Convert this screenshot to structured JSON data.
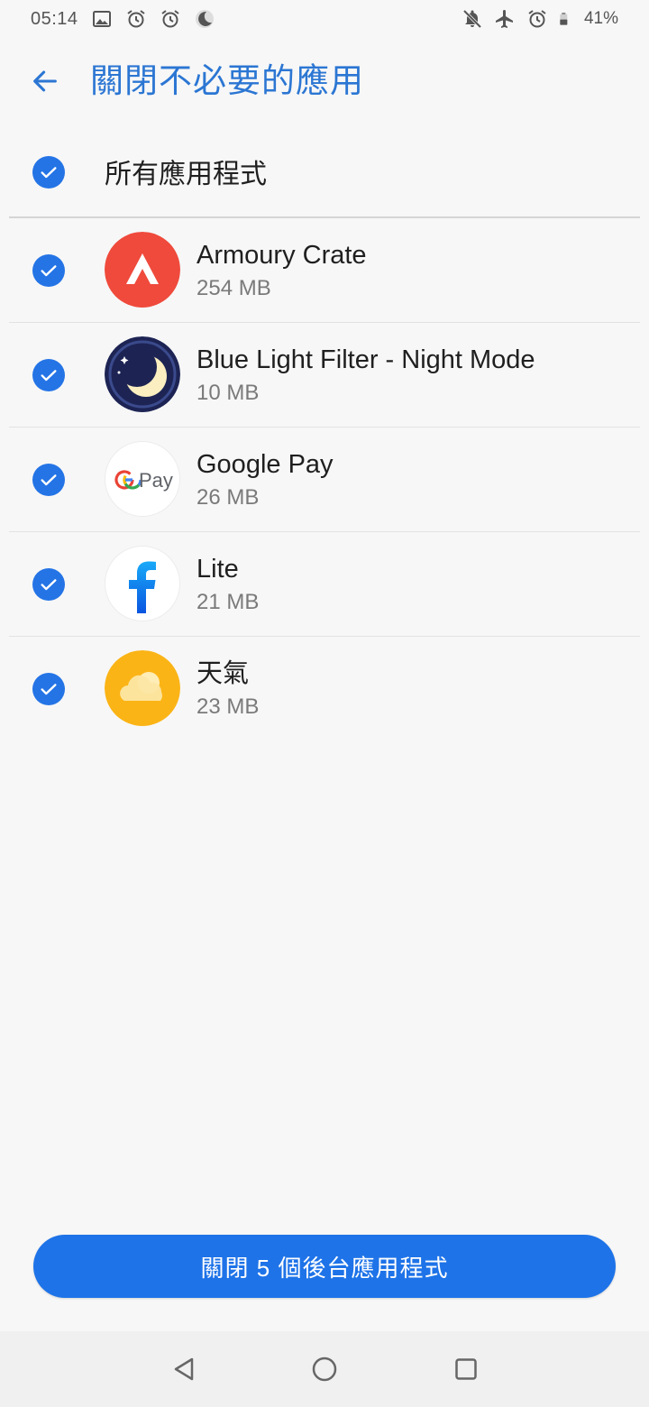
{
  "status_bar": {
    "time": "05:14",
    "battery_percent": "41%",
    "left_icons": [
      "image-icon",
      "alarm-icon",
      "alarm-icon",
      "moon-icon"
    ],
    "right_icons": [
      "notifications-off-icon",
      "airplane-mode-icon",
      "alarm-icon",
      "battery-icon"
    ]
  },
  "header": {
    "title": "關閉不必要的應用",
    "back_icon": "arrow-left-icon"
  },
  "select_all": {
    "label": "所有應用程式",
    "checked": true
  },
  "apps": [
    {
      "name": "Armoury Crate",
      "size": "254 MB",
      "checked": true,
      "icon": "armoury-crate-icon"
    },
    {
      "name": "Blue Light Filter - Night Mode",
      "size": "10 MB",
      "checked": true,
      "icon": "blue-light-filter-icon"
    },
    {
      "name": "Google Pay",
      "size": "26 MB",
      "checked": true,
      "icon": "google-pay-icon",
      "icon_text": "Pay"
    },
    {
      "name": "Lite",
      "size": "21 MB",
      "checked": true,
      "icon": "facebook-lite-icon"
    },
    {
      "name": "天氣",
      "size": "23 MB",
      "checked": true,
      "icon": "weather-icon"
    }
  ],
  "action_button": {
    "label": "關閉 5 個後台應用程式"
  },
  "nav_bar": {
    "buttons": [
      "back-triangle-icon",
      "home-circle-icon",
      "recents-square-icon"
    ]
  },
  "colors": {
    "accent": "#1e73e8",
    "title": "#2b76d3",
    "armoury_red": "#ef4a3c",
    "night_navy": "#1d2454",
    "weather_yellow": "#fbb416"
  }
}
